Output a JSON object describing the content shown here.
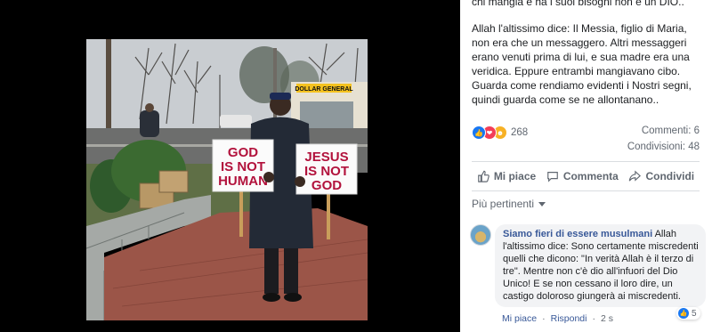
{
  "post": {
    "top_text": "chi mangia e ha i suoi bisogni non e un DIO..",
    "body": "Allah l'altissimo dice: Il Messia, figlio di Maria, non era che un messaggero. Altri messaggeri erano venuti prima di lui, e sua madre era una veridica. Eppure entrambi mangiavano cibo. Guarda come rendiamo evidenti i Nostri segni, quindi guarda come se ne allontanano.."
  },
  "photo": {
    "sign_left": [
      "GOD",
      "IS NOT",
      "HUMAN"
    ],
    "sign_right": [
      "JESUS",
      "IS NOT",
      "GOD"
    ],
    "store_sign": "DOLLAR GENERAL"
  },
  "stats": {
    "reactions_count": "268",
    "comments": "Commenti: 6",
    "shares": "Condivisioni: 48"
  },
  "actions": {
    "like": "Mi piace",
    "comment": "Commenta",
    "share": "Condividi"
  },
  "relevance": "Più pertinenti",
  "comment": {
    "author": "Siamo fieri di essere musulmani",
    "text": "Allah l'altissimo dice: Sono certamente miscredenti quelli che dicono: \"In verità Allah è il terzo di tre\". Mentre non c'è dio all'infuori del Dio Unico! E se non cessano il loro dire, un castigo doloroso giungerà ai miscredenti.",
    "like": "Mi piace",
    "sep": "·",
    "reply": "Rispondi",
    "time": "2 s",
    "reactions": "5"
  },
  "colors": {
    "link": "#385898",
    "like_blue": "#1877f2",
    "love_red": "#f33e58",
    "haha_yellow": "#f7b125"
  }
}
